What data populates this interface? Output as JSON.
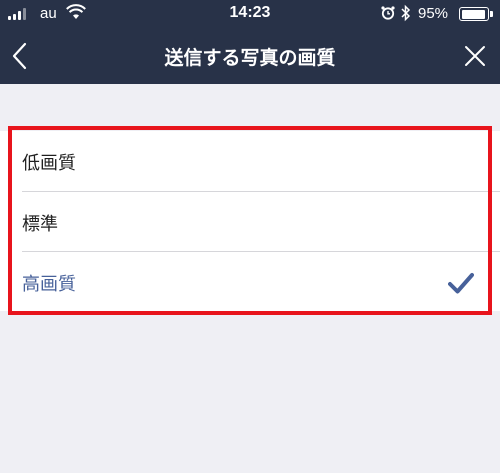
{
  "status_bar": {
    "carrier": "au",
    "time": "14:23",
    "battery_percent": "95%",
    "battery_level": 0.95,
    "icons": [
      "signal-icon",
      "wifi-icon",
      "alarm-icon",
      "bluetooth-icon",
      "battery-icon"
    ]
  },
  "nav": {
    "title": "送信する写真の画質",
    "back_icon": "chevron-left-icon",
    "close_icon": "close-icon"
  },
  "quality_options": {
    "items": [
      {
        "label": "低画質",
        "selected": false
      },
      {
        "label": "標準",
        "selected": false
      },
      {
        "label": "高画質",
        "selected": true
      }
    ],
    "check_icon": "checkmark-icon"
  },
  "colors": {
    "bar_background": "#283248",
    "page_background": "#efeff4",
    "selected_text": "#47619a",
    "highlight_border": "#e8141c"
  }
}
